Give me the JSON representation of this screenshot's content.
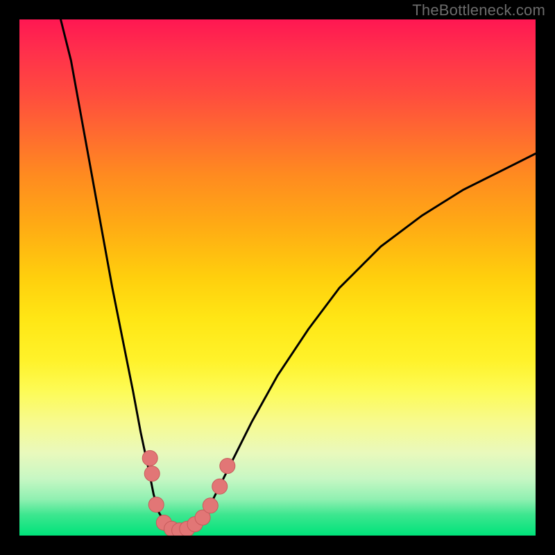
{
  "watermark": "TheBottleneck.com",
  "colors": {
    "frame": "#000000",
    "curve": "#000000",
    "marker_fill": "#e27676",
    "marker_stroke": "#c75b5b",
    "gradient_stops": [
      "#ff1752",
      "#ff2f4c",
      "#ff4a3f",
      "#ff6a30",
      "#ff8a20",
      "#ffab14",
      "#ffcf0d",
      "#ffe615",
      "#fff22a",
      "#fdfb56",
      "#f7fa8f",
      "#e9f9bc",
      "#c7f7c4",
      "#8ff0b1",
      "#3ce68f",
      "#00e37a"
    ]
  },
  "chart_data": {
    "type": "line",
    "title": "",
    "xlabel": "",
    "ylabel": "",
    "xlim": [
      0,
      100
    ],
    "ylim": [
      0,
      100
    ],
    "grid": false,
    "legend": false,
    "curves": {
      "left": [
        {
          "x": 8.0,
          "y": 100.0
        },
        {
          "x": 10.0,
          "y": 92.0
        },
        {
          "x": 12.0,
          "y": 81.0
        },
        {
          "x": 14.0,
          "y": 70.0
        },
        {
          "x": 16.0,
          "y": 59.0
        },
        {
          "x": 18.0,
          "y": 48.0
        },
        {
          "x": 20.0,
          "y": 38.0
        },
        {
          "x": 22.0,
          "y": 28.0
        },
        {
          "x": 23.5,
          "y": 20.0
        },
        {
          "x": 25.0,
          "y": 13.0
        },
        {
          "x": 26.0,
          "y": 8.0
        },
        {
          "x": 27.0,
          "y": 4.5
        },
        {
          "x": 28.5,
          "y": 2.0
        },
        {
          "x": 30.0,
          "y": 1.0
        }
      ],
      "right": [
        {
          "x": 32.0,
          "y": 1.0
        },
        {
          "x": 34.0,
          "y": 2.0
        },
        {
          "x": 36.0,
          "y": 4.0
        },
        {
          "x": 38.0,
          "y": 8.0
        },
        {
          "x": 41.0,
          "y": 14.0
        },
        {
          "x": 45.0,
          "y": 22.0
        },
        {
          "x": 50.0,
          "y": 31.0
        },
        {
          "x": 56.0,
          "y": 40.0
        },
        {
          "x": 62.0,
          "y": 48.0
        },
        {
          "x": 70.0,
          "y": 56.0
        },
        {
          "x": 78.0,
          "y": 62.0
        },
        {
          "x": 86.0,
          "y": 67.0
        },
        {
          "x": 94.0,
          "y": 71.0
        },
        {
          "x": 100.0,
          "y": 74.0
        }
      ]
    },
    "markers": [
      {
        "x": 25.3,
        "y": 15.0
      },
      {
        "x": 25.7,
        "y": 12.0
      },
      {
        "x": 26.5,
        "y": 6.0
      },
      {
        "x": 28.0,
        "y": 2.5
      },
      {
        "x": 29.5,
        "y": 1.3
      },
      {
        "x": 31.0,
        "y": 1.0
      },
      {
        "x": 32.5,
        "y": 1.3
      },
      {
        "x": 34.0,
        "y": 2.2
      },
      {
        "x": 35.5,
        "y": 3.5
      },
      {
        "x": 37.0,
        "y": 5.8
      },
      {
        "x": 38.8,
        "y": 9.5
      },
      {
        "x": 40.3,
        "y": 13.5
      }
    ]
  }
}
